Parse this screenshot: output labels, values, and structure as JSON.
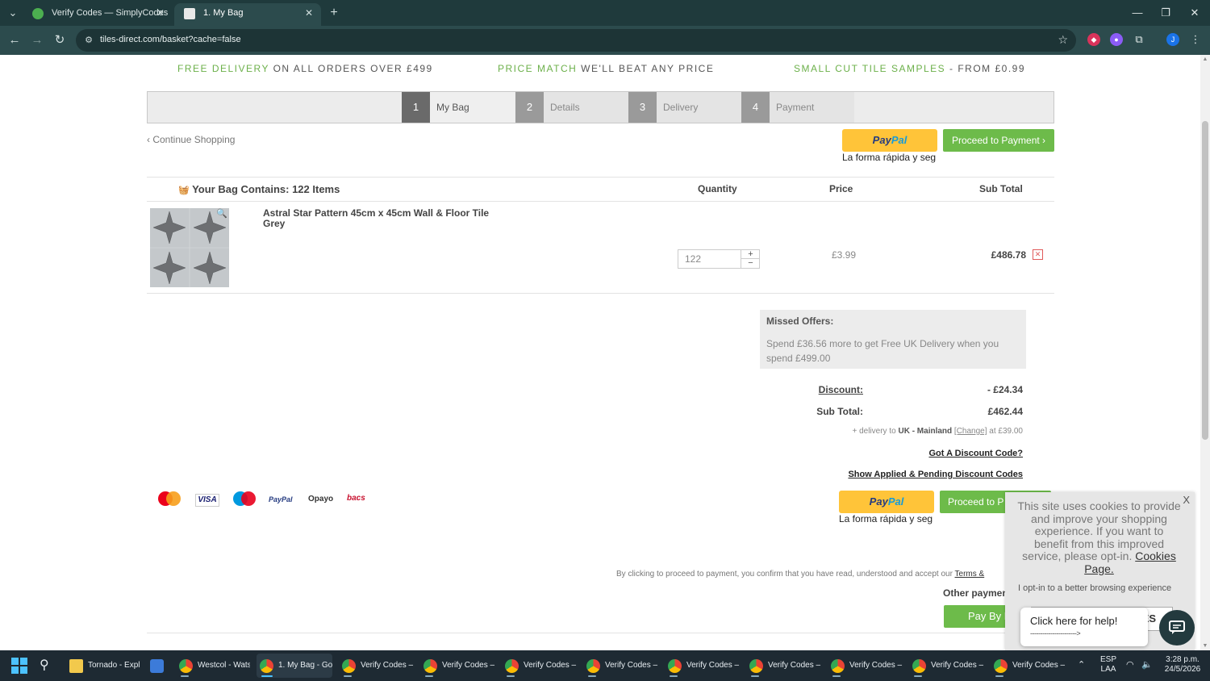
{
  "browser": {
    "tabs": [
      {
        "title": "Verify Codes — SimplyCodes",
        "active": false
      },
      {
        "title": "1. My Bag",
        "active": true
      }
    ],
    "url": "tiles-direct.com/basket?cache=false",
    "profile_initial": "J"
  },
  "promo": [
    {
      "highlight": "FREE DELIVERY",
      "rest": " ON ALL ORDERS OVER £499"
    },
    {
      "highlight": "PRICE MATCH",
      "rest": " WE'LL BEAT ANY PRICE"
    },
    {
      "highlight": "SMALL CUT TILE SAMPLES",
      "rest": " - FROM £0.99"
    }
  ],
  "steps": [
    {
      "num": "1",
      "label": "My Bag"
    },
    {
      "num": "2",
      "label": "Details"
    },
    {
      "num": "3",
      "label": "Delivery"
    },
    {
      "num": "4",
      "label": "Payment"
    }
  ],
  "continue_shopping": "‹ Continue Shopping",
  "paypal": {
    "pay": "Pay",
    "pal": "Pal",
    "sub": "La forma rápida y seg"
  },
  "proceed_label": "Proceed to Payment ›",
  "proceed_label_bottom": "Proceed to P",
  "bag": {
    "title": "Your Bag Contains: 122 Items",
    "col_quantity": "Quantity",
    "col_price": "Price",
    "col_subtotal": "Sub Total",
    "item": {
      "name": "Astral Star Pattern 45cm x 45cm Wall & Floor Tile Grey",
      "quantity": "122",
      "price": "£3.99",
      "subtotal": "£486.78"
    }
  },
  "missed": {
    "title": "Missed Offers:",
    "text": "Spend £36.56 more to get Free UK Delivery when you spend £499.00"
  },
  "totals": {
    "discount_label": "Discount:",
    "discount_value": "- £24.34",
    "subtotal_label": "Sub Total:",
    "subtotal_value": "£462.44",
    "delivery_prefix": "+ delivery to ",
    "delivery_region": "UK - Mainland",
    "delivery_change": "[Change]",
    "delivery_suffix": " at £39.00",
    "discount_code_link": "Got A Discount Code?",
    "show_codes_link": "Show Applied & Pending Discount Codes"
  },
  "payment_logos": [
    "mastercard",
    "VISA",
    "maestro",
    "PayPal",
    "Opayo",
    "bacs"
  ],
  "terms": {
    "text": "By clicking to proceed to payment, you confirm that you have read, understood and accept our ",
    "link": "Terms &"
  },
  "other_payment": "Other paymen",
  "pay_by": "Pay By B",
  "cookie": {
    "message": "This site uses cookies to provide and improve your shopping experience. If you want to benefit from this improved service, please opt-in.",
    "link": "Cookies Page.",
    "close": "X",
    "optin": "I opt-in to a better browsing experience",
    "btn_partial": "ES"
  },
  "help": {
    "text": "Click here for help!",
    "arrow": "----------------------->"
  },
  "taskbar": {
    "items": [
      {
        "label": "Tornado - Expl",
        "color": "#f2c94c"
      },
      {
        "label": "",
        "color": "#3c7bd9"
      },
      {
        "label": "Westcol - Wats",
        "color": "#4caf50"
      },
      {
        "label": "1. My Bag - Go",
        "color": "#4caf50",
        "active": true
      },
      {
        "label": "Verify Codes –",
        "color": "#4caf50"
      },
      {
        "label": "Verify Codes –",
        "color": "#4caf50"
      },
      {
        "label": "Verify Codes –",
        "color": "#4caf50"
      },
      {
        "label": "Verify Codes –",
        "color": "#4caf50"
      },
      {
        "label": "Verify Codes –",
        "color": "#4caf50"
      },
      {
        "label": "Verify Codes –",
        "color": "#4caf50"
      },
      {
        "label": "Verify Codes –",
        "color": "#4caf50"
      },
      {
        "label": "Verify Codes –",
        "color": "#4caf50"
      },
      {
        "label": "Verify Codes –",
        "color": "#4caf50"
      }
    ],
    "lang": "ESP",
    "lang2": "LAA",
    "time": "3:28 p.m.",
    "date": "24/5/2026"
  },
  "colors": {
    "accent_green": "#6dbb4a",
    "paypal_yellow": "#ffc439",
    "chrome_bg": "#1f3a3c"
  }
}
